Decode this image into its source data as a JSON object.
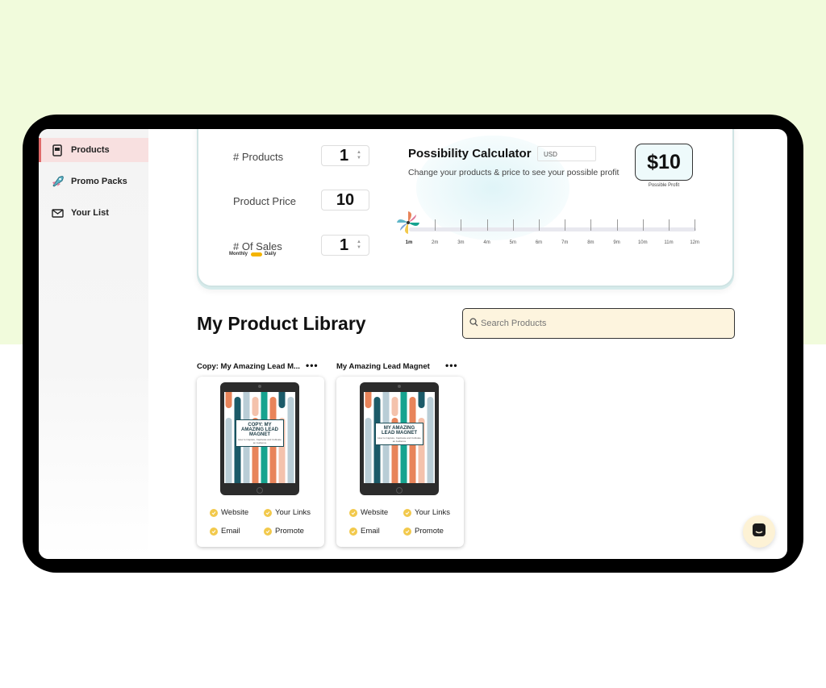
{
  "sidebar": {
    "items": [
      {
        "label": "Products",
        "icon": "book-icon",
        "active": true
      },
      {
        "label": "Promo Packs",
        "icon": "rocket-icon",
        "active": false
      },
      {
        "label": "Your List",
        "icon": "mail-icon",
        "active": false
      }
    ]
  },
  "calculator": {
    "products_label": "# Products",
    "products_value": "1",
    "price_label": "Product Price",
    "price_value": "10",
    "sales_label": "# Of Sales",
    "sales_value": "1",
    "toggle_left": "Monthly",
    "toggle_right": "Daily",
    "title": "Possibility Calculator",
    "currency": "USD",
    "description": "Change your products & price to see your possible profit",
    "profit_value": "$10",
    "profit_caption": "Possible Profit",
    "months": [
      "1m",
      "2m",
      "3m",
      "4m",
      "5m",
      "6m",
      "7m",
      "8m",
      "9m",
      "10m",
      "11m",
      "12m"
    ],
    "selected_month": "1m"
  },
  "library": {
    "title": "My Product Library",
    "search_placeholder": "Search Products",
    "more_label": "•••",
    "products": [
      {
        "name": "Copy: My Amazing Lead M...",
        "cover_title": "COPY: MY AMAZING LEAD MAGNET",
        "cover_subtitle": "How to Capture, Captivate and Cultivate an Audience",
        "actions": [
          "Website",
          "Your Links",
          "Email",
          "Promote"
        ]
      },
      {
        "name": "My Amazing Lead Magnet",
        "cover_title": "MY AMAZING LEAD MAGNET",
        "cover_subtitle": "How to Capture, Captivate and Cultivate an Audience",
        "actions": [
          "Website",
          "Your Links",
          "Email",
          "Promote"
        ]
      }
    ]
  },
  "colors": {
    "page_top": "#f1fbdc",
    "accent_yellow": "#f2c94c",
    "search_bg": "#fdf4de",
    "active_nav": "#f8e0e0",
    "cover_stripes": [
      "#e8845a",
      "#1b5a68",
      "#b9cdd6",
      "#f4c2ac",
      "#16a38f"
    ]
  },
  "chat": {
    "icon": "chat-icon"
  }
}
